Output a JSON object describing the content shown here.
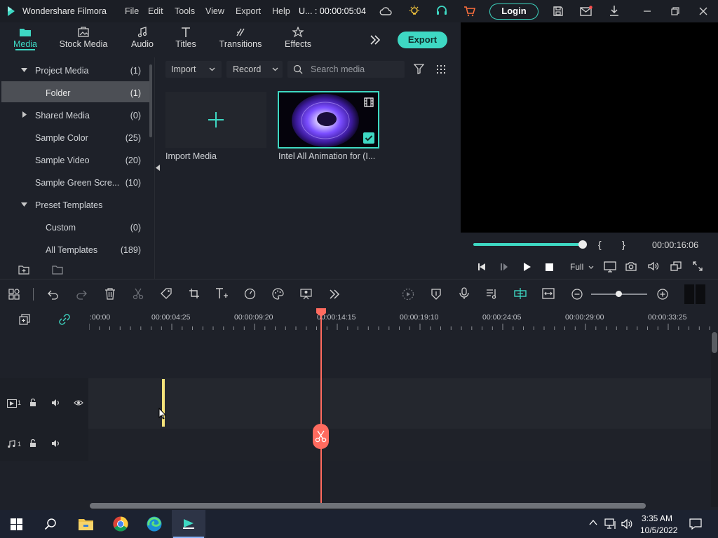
{
  "app": {
    "title": "Wondershare Filmora",
    "menu": [
      "File",
      "Edit",
      "Tools",
      "View",
      "Export",
      "Help"
    ],
    "project": "U... : 00:00:05:04",
    "login_label": "Login"
  },
  "tabs": [
    {
      "label": "Media",
      "icon": "folder-icon",
      "active": true
    },
    {
      "label": "Stock Media",
      "icon": "stock-media-icon"
    },
    {
      "label": "Audio",
      "icon": "music-note-icon"
    },
    {
      "label": "Titles",
      "icon": "text-t-icon"
    },
    {
      "label": "Transitions",
      "icon": "transition-icon"
    },
    {
      "label": "Effects",
      "icon": "effects-icon"
    }
  ],
  "export_label": "Export",
  "library": [
    {
      "label": "Project Media",
      "count": "(1)",
      "expanded": true
    },
    {
      "label": "Folder",
      "count": "(1)",
      "selected": true
    },
    {
      "label": "Shared Media",
      "count": "(0)",
      "expanded": false
    },
    {
      "label": "Sample Color",
      "count": "(25)"
    },
    {
      "label": "Sample Video",
      "count": "(20)"
    },
    {
      "label": "Sample Green Scre...",
      "count": "(10)"
    },
    {
      "label": "Preset Templates",
      "count": "",
      "expanded": true
    },
    {
      "label": "Custom",
      "count": "(0)"
    },
    {
      "label": "All Templates",
      "count": "(189)"
    }
  ],
  "media_toolbar": {
    "import_label": "Import",
    "record_label": "Record",
    "search_placeholder": "Search media"
  },
  "media_items": [
    {
      "label": "Import Media"
    },
    {
      "label": "Intel All Animation for (I..."
    }
  ],
  "player": {
    "timecode": "00:00:16:06",
    "progress": 1.0,
    "mark_in": "{",
    "mark_out": "}",
    "quality": "Full"
  },
  "ruler_ticks": [
    ":00:00",
    "00:00:04:25",
    "00:00:09:20",
    "00:00:14:15",
    "00:00:19:10",
    "00:00:24:05",
    "00:00:29:00",
    "00:00:33:25"
  ],
  "tracks": {
    "video_label": "1",
    "audio_label": "1"
  },
  "taskbar": {
    "time": "3:35 AM",
    "date": "10/5/2022"
  },
  "colors": {
    "accent": "#3ed8c3",
    "playhead": "#ff6b5f",
    "marker": "#f5e27a"
  }
}
